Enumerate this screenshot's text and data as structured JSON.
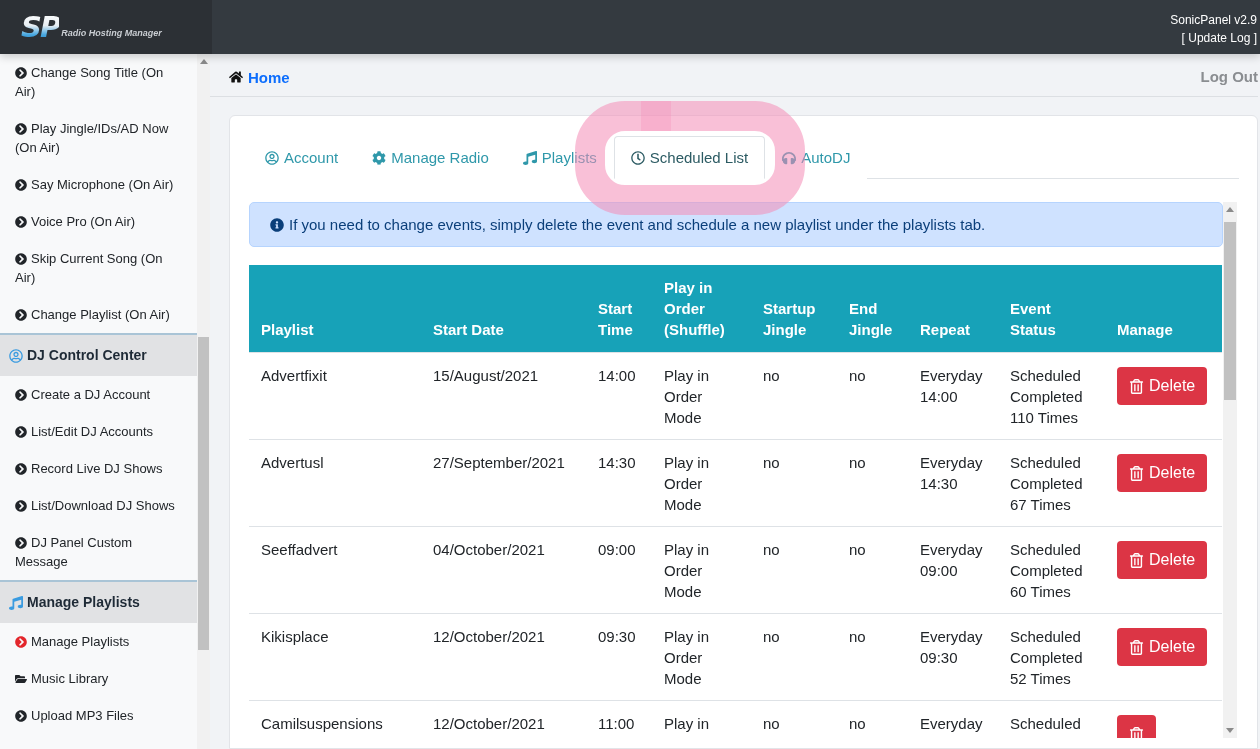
{
  "header": {
    "logo": {
      "mark": "SP",
      "tagline": "Radio Hosting Manager"
    },
    "version": "SonicPanel v2.9",
    "update_log": "[ Update Log ]"
  },
  "sidebar": {
    "groups": [
      {
        "items": [
          {
            "label": "Change Song Title (On Air)",
            "kind": "link",
            "selected": false
          },
          {
            "label": "Play Jingle/IDs/AD Now (On Air)",
            "kind": "link",
            "selected": false
          },
          {
            "label": "Say Microphone (On Air)",
            "kind": "link",
            "selected": false
          },
          {
            "label": "Voice Pro (On Air)",
            "kind": "link",
            "selected": false
          },
          {
            "label": "Skip Current Song (On Air)",
            "kind": "link",
            "selected": false
          },
          {
            "label": "Change Playlist (On Air)",
            "kind": "link",
            "selected": false
          }
        ]
      },
      {
        "title": "DJ Control Center",
        "items": [
          {
            "label": "Create a DJ Account",
            "kind": "link",
            "selected": false
          },
          {
            "label": "List/Edit DJ Accounts",
            "kind": "link",
            "selected": false
          },
          {
            "label": "Record Live DJ Shows",
            "kind": "link",
            "selected": false
          },
          {
            "label": "List/Download DJ Shows",
            "kind": "link",
            "selected": false
          },
          {
            "label": "DJ Panel Custom Message",
            "kind": "link",
            "selected": false
          }
        ]
      },
      {
        "title": "Manage Playlists",
        "items": [
          {
            "label": "Manage Playlists",
            "kind": "link",
            "selected": true
          },
          {
            "label": "Music Library",
            "kind": "folder",
            "selected": false
          },
          {
            "label": "Upload MP3 Files",
            "kind": "link",
            "selected": false
          }
        ]
      }
    ]
  },
  "breadcrumb": {
    "label": "Home"
  },
  "log_out": "Log Out",
  "tabs": [
    {
      "label": "Account",
      "selected": false
    },
    {
      "label": "Manage Radio",
      "selected": false
    },
    {
      "label": "Playlists",
      "selected": false
    },
    {
      "label": "Scheduled List",
      "selected": true
    },
    {
      "label": "AutoDJ",
      "selected": false
    }
  ],
  "annotation": {
    "kind": "ring"
  },
  "alert": {
    "text": "If you need to change events, simply delete the event and schedule a new playlist under the playlists tab."
  },
  "table": {
    "columns": [
      "Playlist",
      "Start Date",
      "Start Time",
      "Play in Order (Shuffle)",
      "Startup Jingle",
      "End Jingle",
      "Repeat",
      "Event Status",
      "Manage"
    ],
    "rows": [
      {
        "cells": [
          "Advertfixit",
          "15/August/2021",
          "14:00",
          "Play in Order Mode",
          "no",
          "no",
          "Everyday 14:00",
          "Scheduled Completed 110 Times"
        ],
        "action": "Delete"
      },
      {
        "cells": [
          "Advertusl",
          "27/September/2021",
          "14:30",
          "Play in Order Mode",
          "no",
          "no",
          "Everyday 14:30",
          "Scheduled Completed 67 Times"
        ],
        "action": "Delete"
      },
      {
        "cells": [
          "Seeffadvert",
          "04/October/2021",
          "09:00",
          "Play in Order Mode",
          "no",
          "no",
          "Everyday 09:00",
          "Scheduled Completed 60 Times"
        ],
        "action": "Delete"
      },
      {
        "cells": [
          "Kikisplace",
          "12/October/2021",
          "09:30",
          "Play in Order Mode",
          "no",
          "no",
          "Everyday 09:30",
          "Scheduled Completed 52 Times"
        ],
        "action": "Delete"
      },
      {
        "cells": [
          "Camilsuspensions",
          "12/October/2021",
          "11:00",
          "Play in",
          "no",
          "no",
          "Everyday",
          "Scheduled"
        ]
      }
    ]
  }
}
